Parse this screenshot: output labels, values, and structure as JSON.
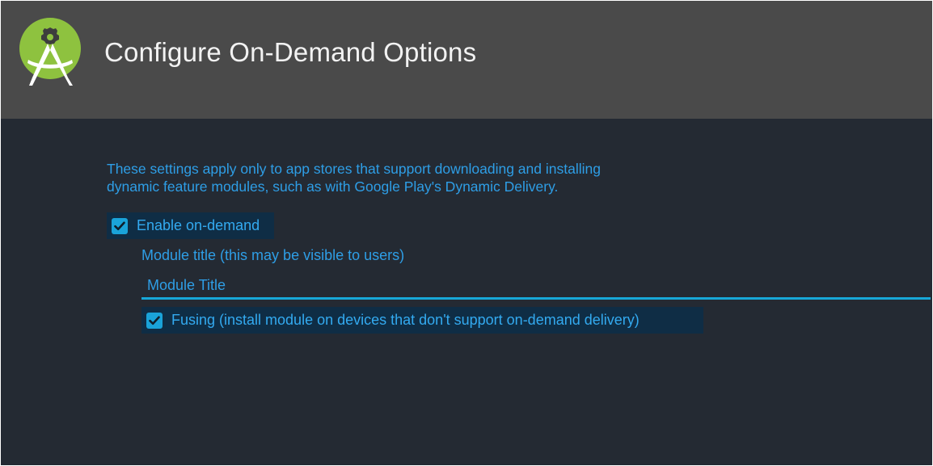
{
  "header": {
    "title": "Configure On-Demand Options",
    "logo_icon": "android-studio-logo-icon"
  },
  "description": {
    "line1": "These settings apply only to app stores that support downloading and installing",
    "line2": "dynamic feature modules, such as with Google Play's Dynamic Delivery."
  },
  "enable_on_demand": {
    "label": "Enable on-demand",
    "checked": true
  },
  "module_title": {
    "label": "Module title (this may be visible to users)",
    "value": "Module Title"
  },
  "fusing": {
    "label": "Fusing (install module on devices that don't support on-demand delivery)",
    "checked": true
  },
  "colors": {
    "header_bg": "#4a4a4a",
    "body_bg": "#242a33",
    "accent_text": "#2e9ee6",
    "checkbox": "#1aa3d9",
    "selection_bg": "#0f2d45",
    "input_underline": "#17a7d8",
    "logo_green": "#8ec23f"
  }
}
